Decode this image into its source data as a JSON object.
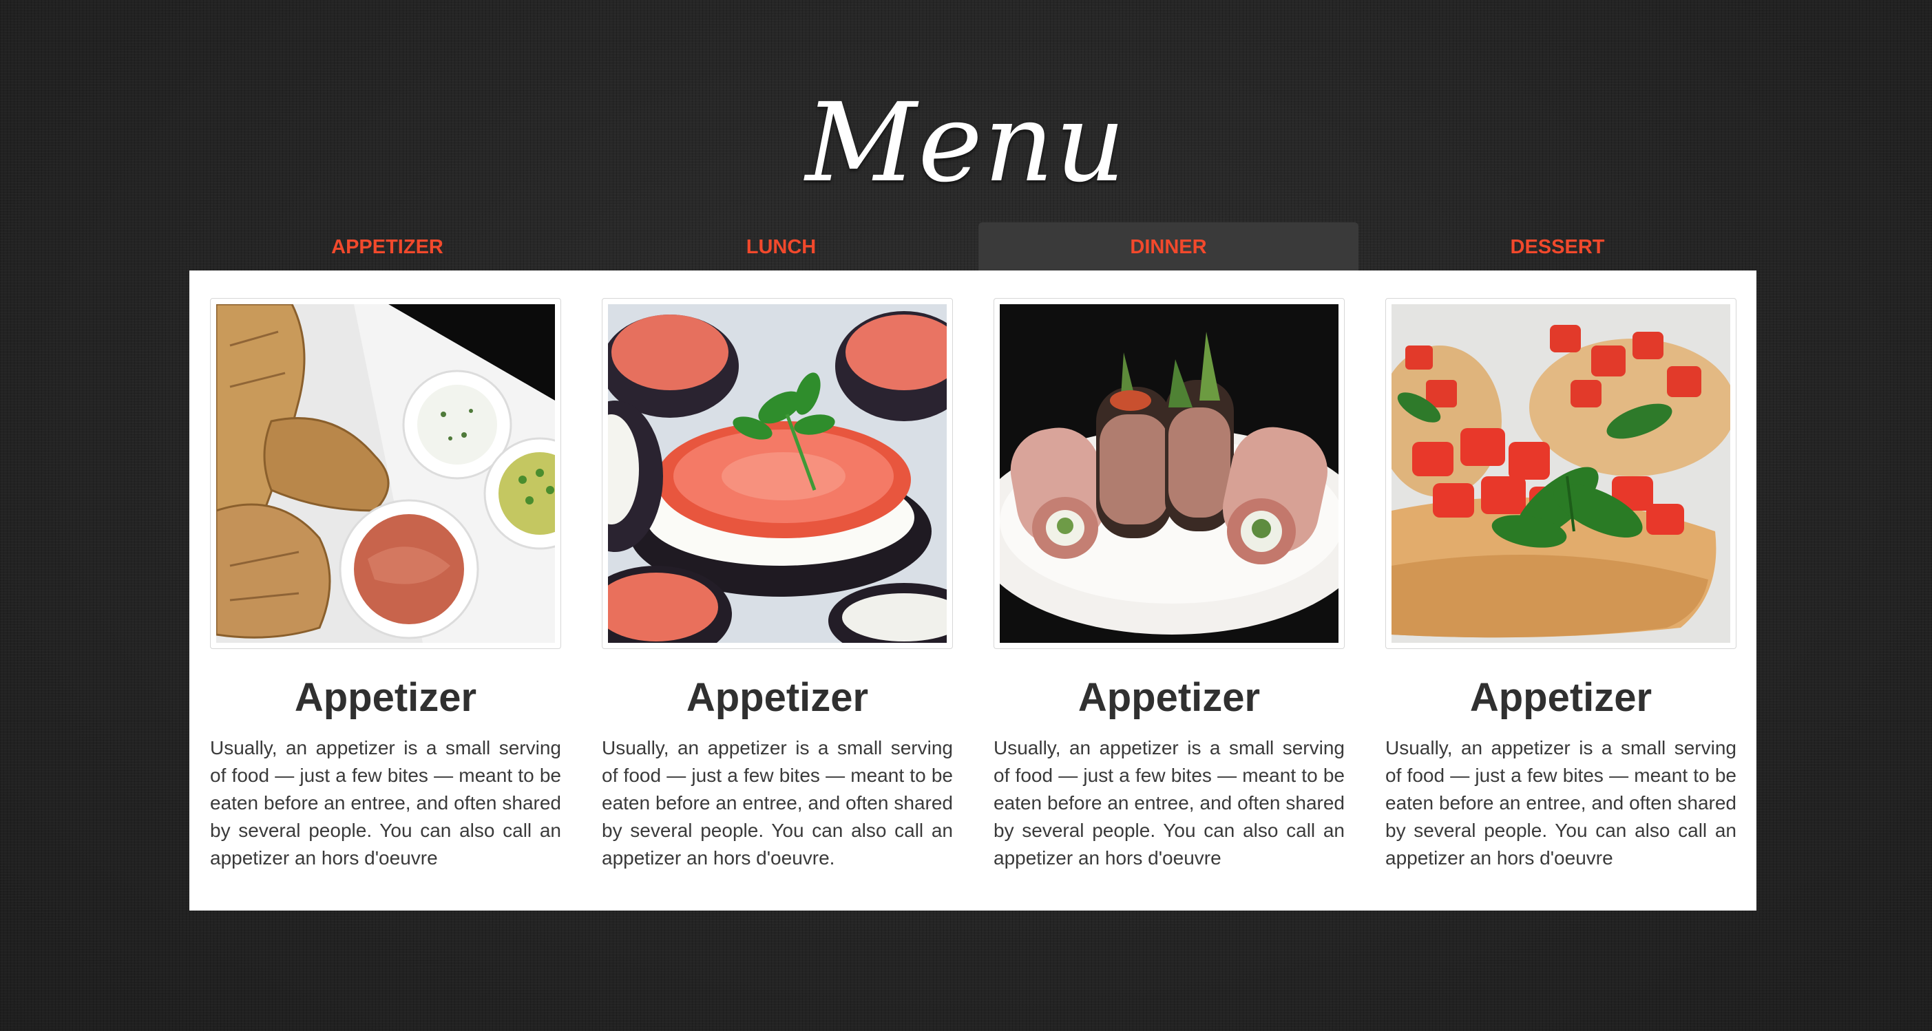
{
  "page": {
    "title": "Menu"
  },
  "tabs": [
    {
      "label": "APPETIZER",
      "active": false
    },
    {
      "label": "LUNCH",
      "active": false
    },
    {
      "label": "DINNER",
      "active": true
    },
    {
      "label": "DESSERT",
      "active": false
    }
  ],
  "cards": [
    {
      "title": "Appetizer",
      "description": "Usually, an appetizer is a small serving of food — just a few bites — meant to be eaten before an entree, and often shared by several people. You can also call an appetizer an hors d'oeuvre",
      "image": "bread-and-dips-photo"
    },
    {
      "title": "Appetizer",
      "description": "Usually, an appetizer is a small serving of food — just a few bites — meant to be eaten before an entree, and often shared by several people. You can also call an appetizer an hors d'oeuvre.",
      "image": "eggplant-tomato-bites-photo"
    },
    {
      "title": "Appetizer",
      "description": "Usually, an appetizer is a small serving of food — just a few bites — meant to be eaten before an entree, and often shared by several people. You can also call an appetizer an hors d'oeuvre",
      "image": "meat-rolls-plate-photo"
    },
    {
      "title": "Appetizer",
      "description": "Usually, an appetizer is a small serving of food — just a few bites — meant to be eaten before an entree, and often shared by several people. You can also call an appetizer an hors d'oeuvre",
      "image": "bruschetta-photo"
    }
  ],
  "colors": {
    "accent": "#f2492c",
    "background": "#262626",
    "panel": "#ffffff",
    "active_tab": "#3a3a3a",
    "heading_text": "#303030"
  }
}
